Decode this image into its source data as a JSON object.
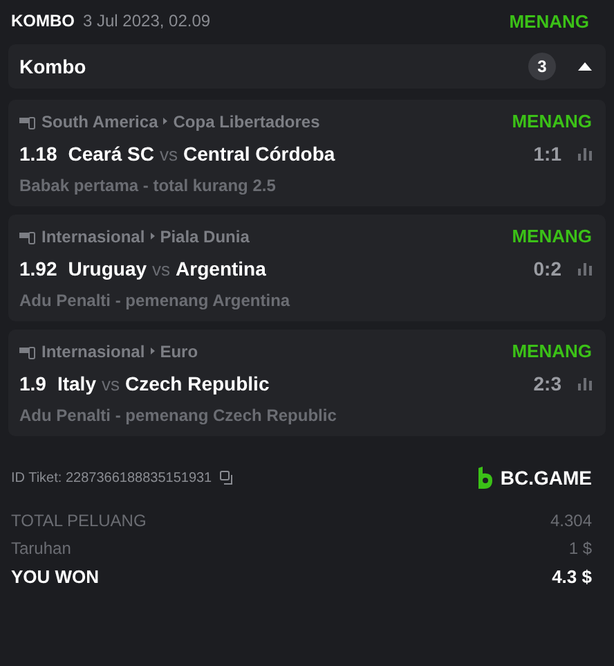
{
  "header": {
    "type": "KOMBO",
    "date": "3 Jul 2023, 02.09",
    "status": "MENANG"
  },
  "combo": {
    "title": "Kombo",
    "count": "3",
    "expanded": true
  },
  "bets": [
    {
      "region": "South America",
      "league": "Copa Libertadores",
      "status": "MENANG",
      "odds": "1.18",
      "home": "Ceará SC",
      "vs": "vs",
      "away": "Central Córdoba",
      "score": "1:1",
      "market": "Babak pertama - total kurang 2.5"
    },
    {
      "region": "Internasional",
      "league": "Piala Dunia",
      "status": "MENANG",
      "odds": "1.92",
      "home": "Uruguay",
      "vs": "vs",
      "away": "Argentina",
      "score": "0:2",
      "market": "Adu Penalti - pemenang Argentina"
    },
    {
      "region": "Internasional",
      "league": "Euro",
      "status": "MENANG",
      "odds": "1.9",
      "home": "Italy",
      "vs": "vs",
      "away": "Czech Republic",
      "score": "2:3",
      "market": "Adu Penalti - pemenang Czech Republic"
    }
  ],
  "ticket": {
    "label": "ID Tiket: 2287366188835151931",
    "brand": "BC.GAME"
  },
  "totals": [
    {
      "kind": "muted",
      "label": "TOTAL PELUANG",
      "value": "4.304"
    },
    {
      "kind": "muted",
      "label": "Taruhan",
      "value": "1 $"
    },
    {
      "kind": "strong",
      "label": "YOU WON",
      "value": "4.3 $"
    }
  ]
}
